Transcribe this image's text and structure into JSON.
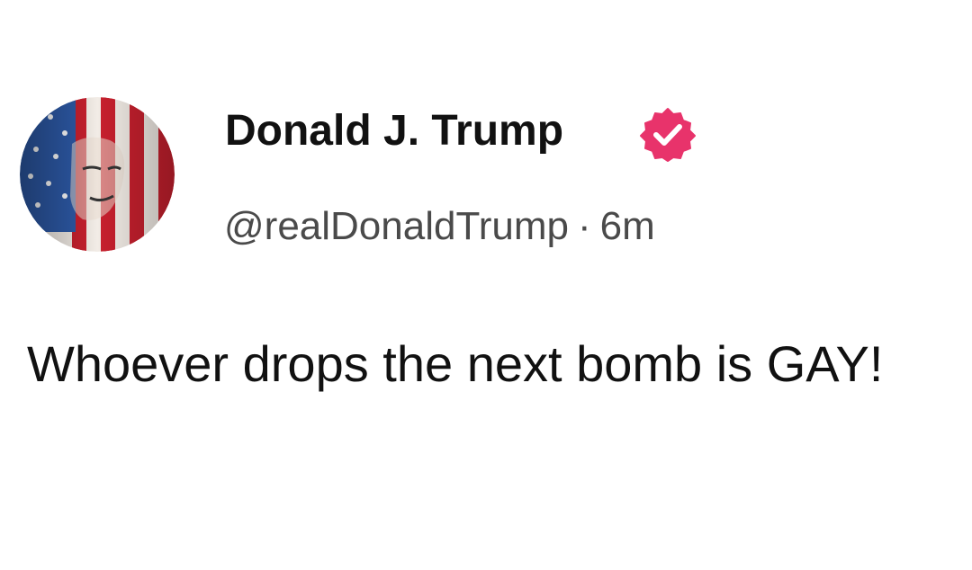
{
  "author": {
    "name": "Donald J. Trump",
    "handle": "@realDonaldTrump",
    "separator": "·",
    "time_ago": "6m",
    "verified": true,
    "verified_color": "#e8336b",
    "avatar_description_icon": "flag-portrait-avatar"
  },
  "post": {
    "text": "Whoever drops the next bomb is GAY!"
  },
  "colors": {
    "background": "#ffffff",
    "text": "#111111",
    "meta_text": "#4a4a4a",
    "flag_red": "#c8202e",
    "flag_blue": "#2d5aa8"
  }
}
